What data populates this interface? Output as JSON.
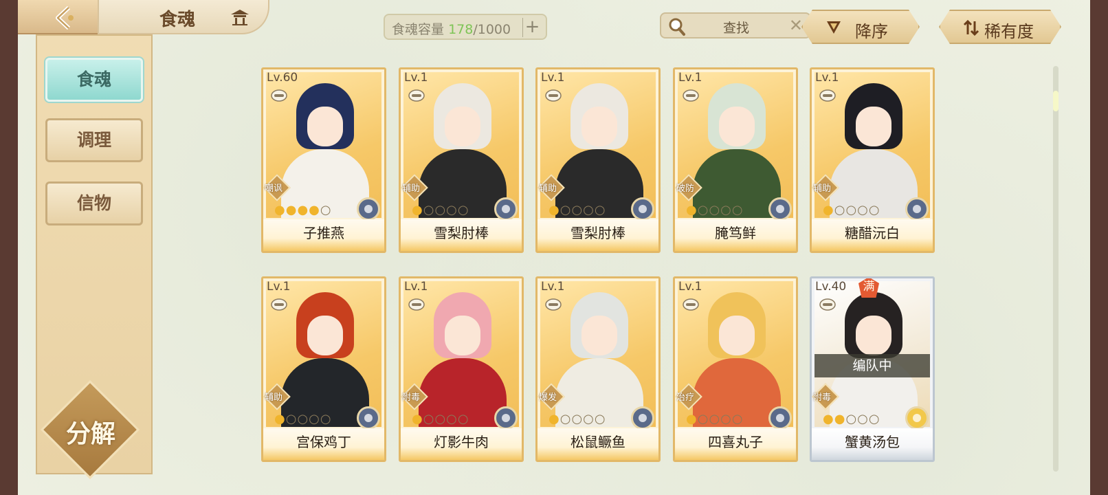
{
  "header": {
    "title": "食魂",
    "capacity_label": "食魂容量",
    "capacity_current": "178",
    "capacity_sep_max": "/1000",
    "search_label": "查找",
    "sort_order_label": "降序",
    "sort_key_label": "稀有度"
  },
  "sidebar": {
    "items": [
      {
        "label": "食魂",
        "active": true
      },
      {
        "label": "调理",
        "active": false
      },
      {
        "label": "信物",
        "active": false
      }
    ],
    "decompose_label": "分解"
  },
  "cards": [
    {
      "level": "Lv.60",
      "role": "嘲讽",
      "name": "子推燕",
      "stars": 4,
      "max_stars": 5,
      "hair": "#23305c",
      "outfit": "#f4f1ea"
    },
    {
      "level": "Lv.1",
      "role": "辅助",
      "name": "雪梨肘棒",
      "stars": 1,
      "max_stars": 5,
      "hair": "#ece8e0",
      "outfit": "#2a2a2a"
    },
    {
      "level": "Lv.1",
      "role": "辅助",
      "name": "雪梨肘棒",
      "stars": 1,
      "max_stars": 5,
      "hair": "#ece8e0",
      "outfit": "#2a2a2a"
    },
    {
      "level": "Lv.1",
      "role": "破防",
      "name": "腌笃鲜",
      "stars": 1,
      "max_stars": 5,
      "hair": "#d8e4d4",
      "outfit": "#3e5a32"
    },
    {
      "level": "Lv.1",
      "role": "辅助",
      "name": "糖醋沅白",
      "stars": 1,
      "max_stars": 5,
      "hair": "#1e1e24",
      "outfit": "#e8e6e2"
    },
    {
      "level": "Lv.1",
      "role": "辅助",
      "name": "宫保鸡丁",
      "stars": 1,
      "max_stars": 5,
      "hair": "#c8401e",
      "outfit": "#23262a"
    },
    {
      "level": "Lv.1",
      "role": "附毒",
      "name": "灯影牛肉",
      "stars": 1,
      "max_stars": 5,
      "hair": "#f0a8b0",
      "outfit": "#b8242a"
    },
    {
      "level": "Lv.1",
      "role": "爆发",
      "name": "松鼠鳜鱼",
      "stars": 1,
      "max_stars": 5,
      "hair": "#e2e4e0",
      "outfit": "#efece2"
    },
    {
      "level": "Lv.1",
      "role": "治疗",
      "name": "四喜丸子",
      "stars": 1,
      "max_stars": 5,
      "hair": "#f0c25a",
      "outfit": "#e0683c"
    },
    {
      "level": "Lv.40",
      "role": "附毒",
      "name": "蟹黄汤包",
      "stars": 2,
      "max_stars": 5,
      "hair": "#262222",
      "outfit": "#f2f0ec",
      "badge": "满",
      "tag": "编队中",
      "special": true
    }
  ],
  "colors": {
    "accent_teal": "#8fd8cf",
    "card_gold": "#e2b868",
    "capacity_green": "#7ec456"
  }
}
